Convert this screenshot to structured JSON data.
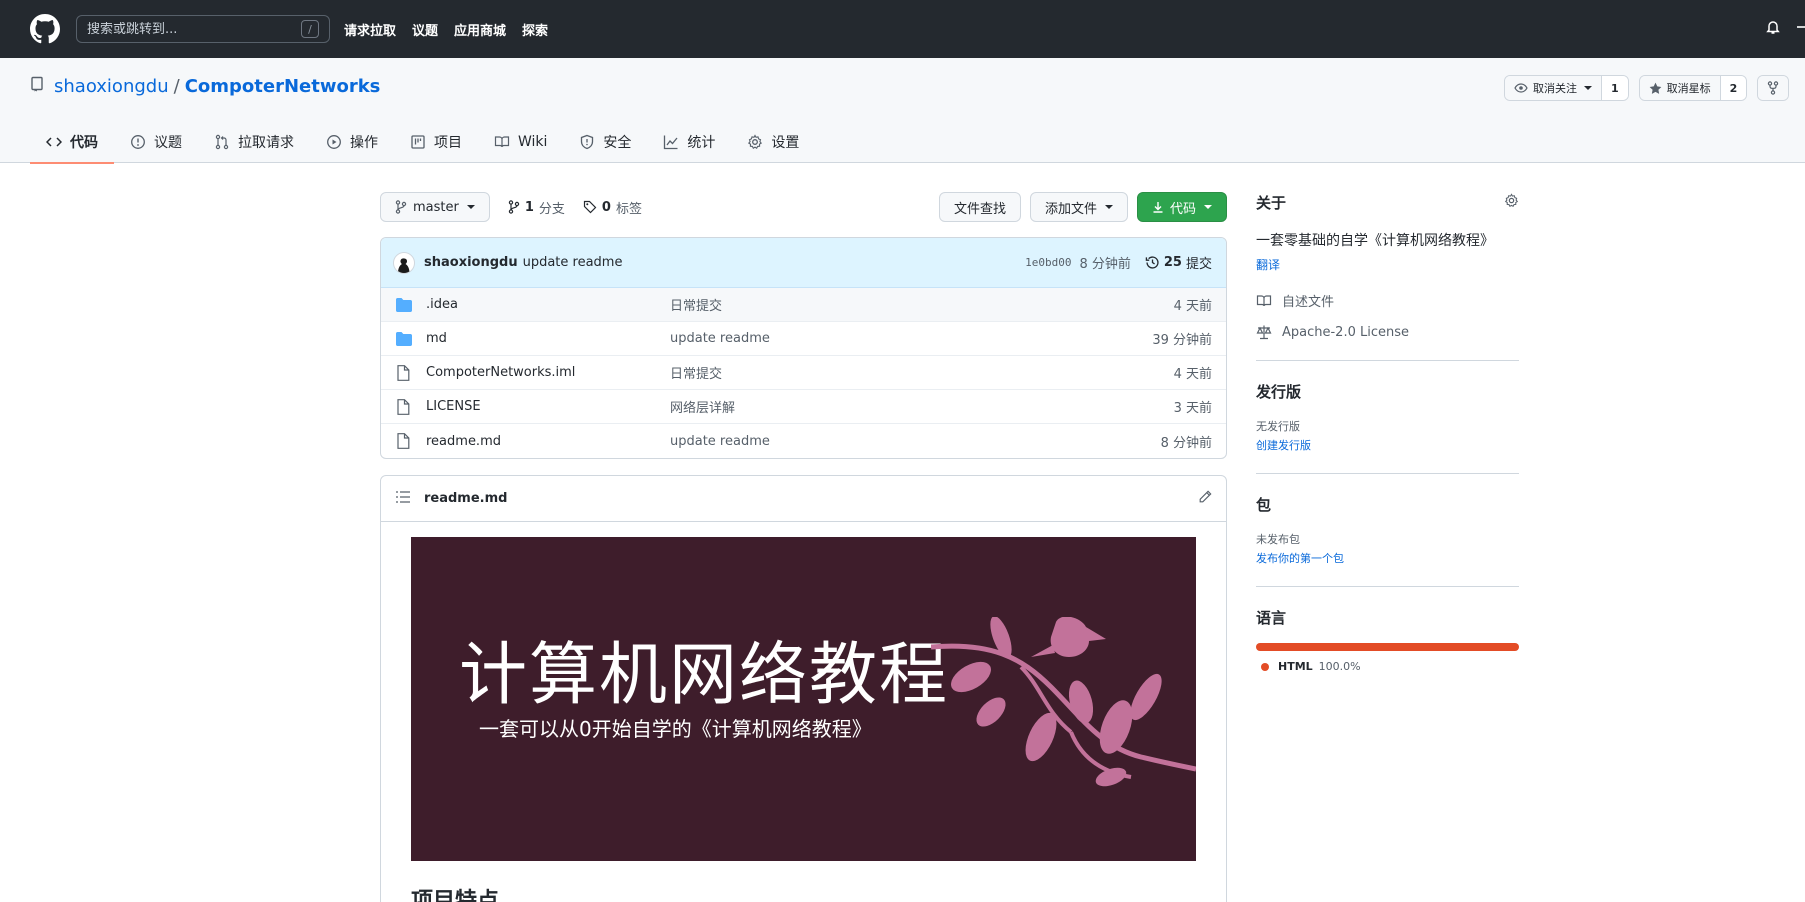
{
  "header": {
    "search_placeholder": "搜索或跳转到...",
    "search_shortcut": "/",
    "nav": [
      "请求拉取",
      "议题",
      "应用商城",
      "探索"
    ]
  },
  "repo": {
    "owner": "shaoxiongdu",
    "separator": "/",
    "name": "CompoterNetworks",
    "watch_label": "取消关注",
    "watch_count": "1",
    "star_label": "取消星标",
    "star_count": "2"
  },
  "tabs": [
    {
      "label": "代码",
      "icon": "code-icon"
    },
    {
      "label": "议题",
      "icon": "issue-icon"
    },
    {
      "label": "拉取请求",
      "icon": "pull-request-icon"
    },
    {
      "label": "操作",
      "icon": "play-icon"
    },
    {
      "label": "项目",
      "icon": "project-icon"
    },
    {
      "label": "Wiki",
      "icon": "book-icon"
    },
    {
      "label": "安全",
      "icon": "shield-icon"
    },
    {
      "label": "统计",
      "icon": "graph-icon"
    },
    {
      "label": "设置",
      "icon": "gear-icon"
    }
  ],
  "toolbar": {
    "branch": "master",
    "branch_count": "1",
    "branch_label": "分支",
    "tag_count": "0",
    "tag_label": "标签",
    "find_file": "文件查找",
    "add_file": "添加文件",
    "code": "代码"
  },
  "commit": {
    "author": "shaoxiongdu",
    "message": "update readme",
    "sha": "1e0bd00",
    "time": "8 分钟前",
    "count": "25",
    "count_label": "提交"
  },
  "files": [
    {
      "type": "folder",
      "name": ".idea",
      "message": "日常提交",
      "age": "4 天前"
    },
    {
      "type": "folder",
      "name": "md",
      "message": "update readme",
      "age": "39 分钟前"
    },
    {
      "type": "file",
      "name": "CompoterNetworks.iml",
      "message": "日常提交",
      "age": "4 天前"
    },
    {
      "type": "file",
      "name": "LICENSE",
      "message": "网络层详解",
      "age": "3 天前"
    },
    {
      "type": "file",
      "name": "readme.md",
      "message": "update readme",
      "age": "8 分钟前"
    }
  ],
  "readme": {
    "filename": "readme.md",
    "banner_title": "计算机网络教程",
    "banner_subtitle": "一套可以从0开始自学的《计算机网络教程》",
    "next_heading": "项目特点"
  },
  "sidebar": {
    "about_title": "关于",
    "description": "一套零基础的自学《计算机网络教程》",
    "translate": "翻译",
    "readme_label": "自述文件",
    "license_label": "Apache-2.0 License",
    "releases_title": "发行版",
    "releases_none": "无发行版",
    "releases_create": "创建发行版",
    "packages_title": "包",
    "packages_none": "未发布包",
    "packages_publish": "发布你的第一个包",
    "languages_title": "语言",
    "language_name": "HTML",
    "language_pct": "100.0%",
    "language_color": "#e34c26"
  },
  "colors": {
    "header_bg": "#24292f",
    "link": "#0969da",
    "green_button": "#2da44e",
    "active_tab_underline": "#fd8c73",
    "banner_bg": "#3e1d2b",
    "banner_art": "#c2729a"
  }
}
